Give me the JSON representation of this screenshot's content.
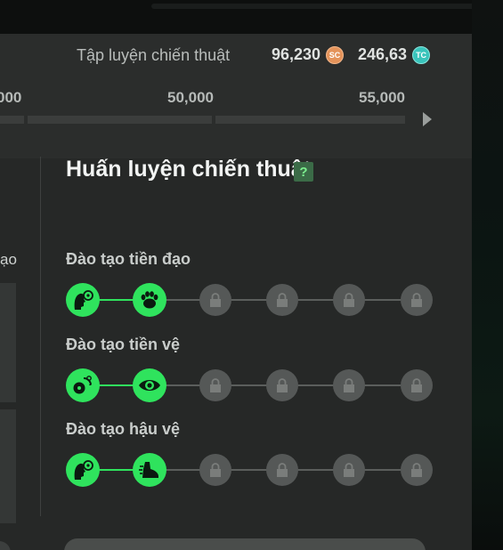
{
  "header": {
    "title": "Tập luyện chiến thuật",
    "currency_sc": {
      "value": "96,230",
      "icon": "SC"
    },
    "currency_tc": {
      "value": "246,63",
      "icon": "TC"
    },
    "milestones": [
      "000",
      "50,000",
      "55,000"
    ]
  },
  "left_panel": {
    "label": "ạo"
  },
  "section": {
    "title": "Huấn luyện chiến thuật",
    "help": "?",
    "tracks": [
      {
        "label": "Đào tạo tiền đạo",
        "nodes": [
          {
            "state": "active",
            "icon": "head-ball-icon"
          },
          {
            "state": "active",
            "icon": "paw-icon"
          },
          {
            "state": "locked",
            "icon": "lock-icon"
          },
          {
            "state": "locked",
            "icon": "lock-icon"
          },
          {
            "state": "locked",
            "icon": "lock-icon"
          },
          {
            "state": "locked",
            "icon": "lock-icon"
          }
        ]
      },
      {
        "label": "Đào tạo tiền vệ",
        "nodes": [
          {
            "state": "active",
            "icon": "ball-swap-icon"
          },
          {
            "state": "active",
            "icon": "eye-icon"
          },
          {
            "state": "locked",
            "icon": "lock-icon"
          },
          {
            "state": "locked",
            "icon": "lock-icon"
          },
          {
            "state": "locked",
            "icon": "lock-icon"
          },
          {
            "state": "locked",
            "icon": "lock-icon"
          }
        ]
      },
      {
        "label": "Đào tạo hậu vệ",
        "nodes": [
          {
            "state": "active",
            "icon": "head-ball-icon"
          },
          {
            "state": "active",
            "icon": "boot-icon"
          },
          {
            "state": "locked",
            "icon": "lock-icon"
          },
          {
            "state": "locked",
            "icon": "lock-icon"
          },
          {
            "state": "locked",
            "icon": "lock-icon"
          },
          {
            "state": "locked",
            "icon": "lock-icon"
          }
        ]
      }
    ]
  },
  "colors": {
    "accent": "#2fe35d",
    "locked": "#555857",
    "panel": "#262827"
  }
}
